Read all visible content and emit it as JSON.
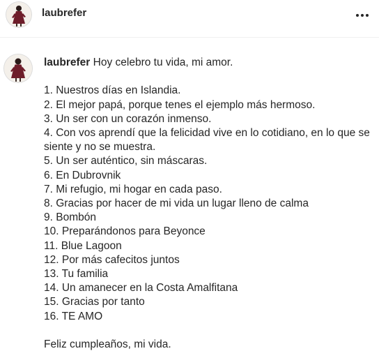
{
  "post": {
    "username": "laubrefer",
    "more_icon": "more-horizontal-icon"
  },
  "caption": {
    "username": "laubrefer",
    "intro": "Hoy celebro tu vida, mi amor.",
    "items": [
      "1. Nuestros días en Islandia.",
      "2. El mejor papá, porque tenes el ejemplo más hermoso.",
      "3. Un ser con un corazón inmenso.",
      "4. Con vos aprendí que la felicidad vive en lo cotidiano, en lo que se siente y no se muestra.",
      "5. Un ser auténtico, sin máscaras.",
      "6. En Dubrovnik",
      "7. Mi refugio, mi hogar en cada paso.",
      "8. Gracias por hacer de mi vida un lugar lleno de calma",
      "9. Bombón",
      "10. Preparándonos para Beyonce",
      "11. Blue Lagoon",
      "12. Por más cafecitos juntos",
      "13. Tu familia",
      "14. Un amanecer en la Costa Amalfitana",
      "15. Gracias por tanto",
      "16. TE AMO"
    ],
    "closing": "Feliz cumpleaños, mi vida."
  },
  "colors": {
    "text": "#262626",
    "divider": "#efefef",
    "dress": "#6e1d2a"
  }
}
